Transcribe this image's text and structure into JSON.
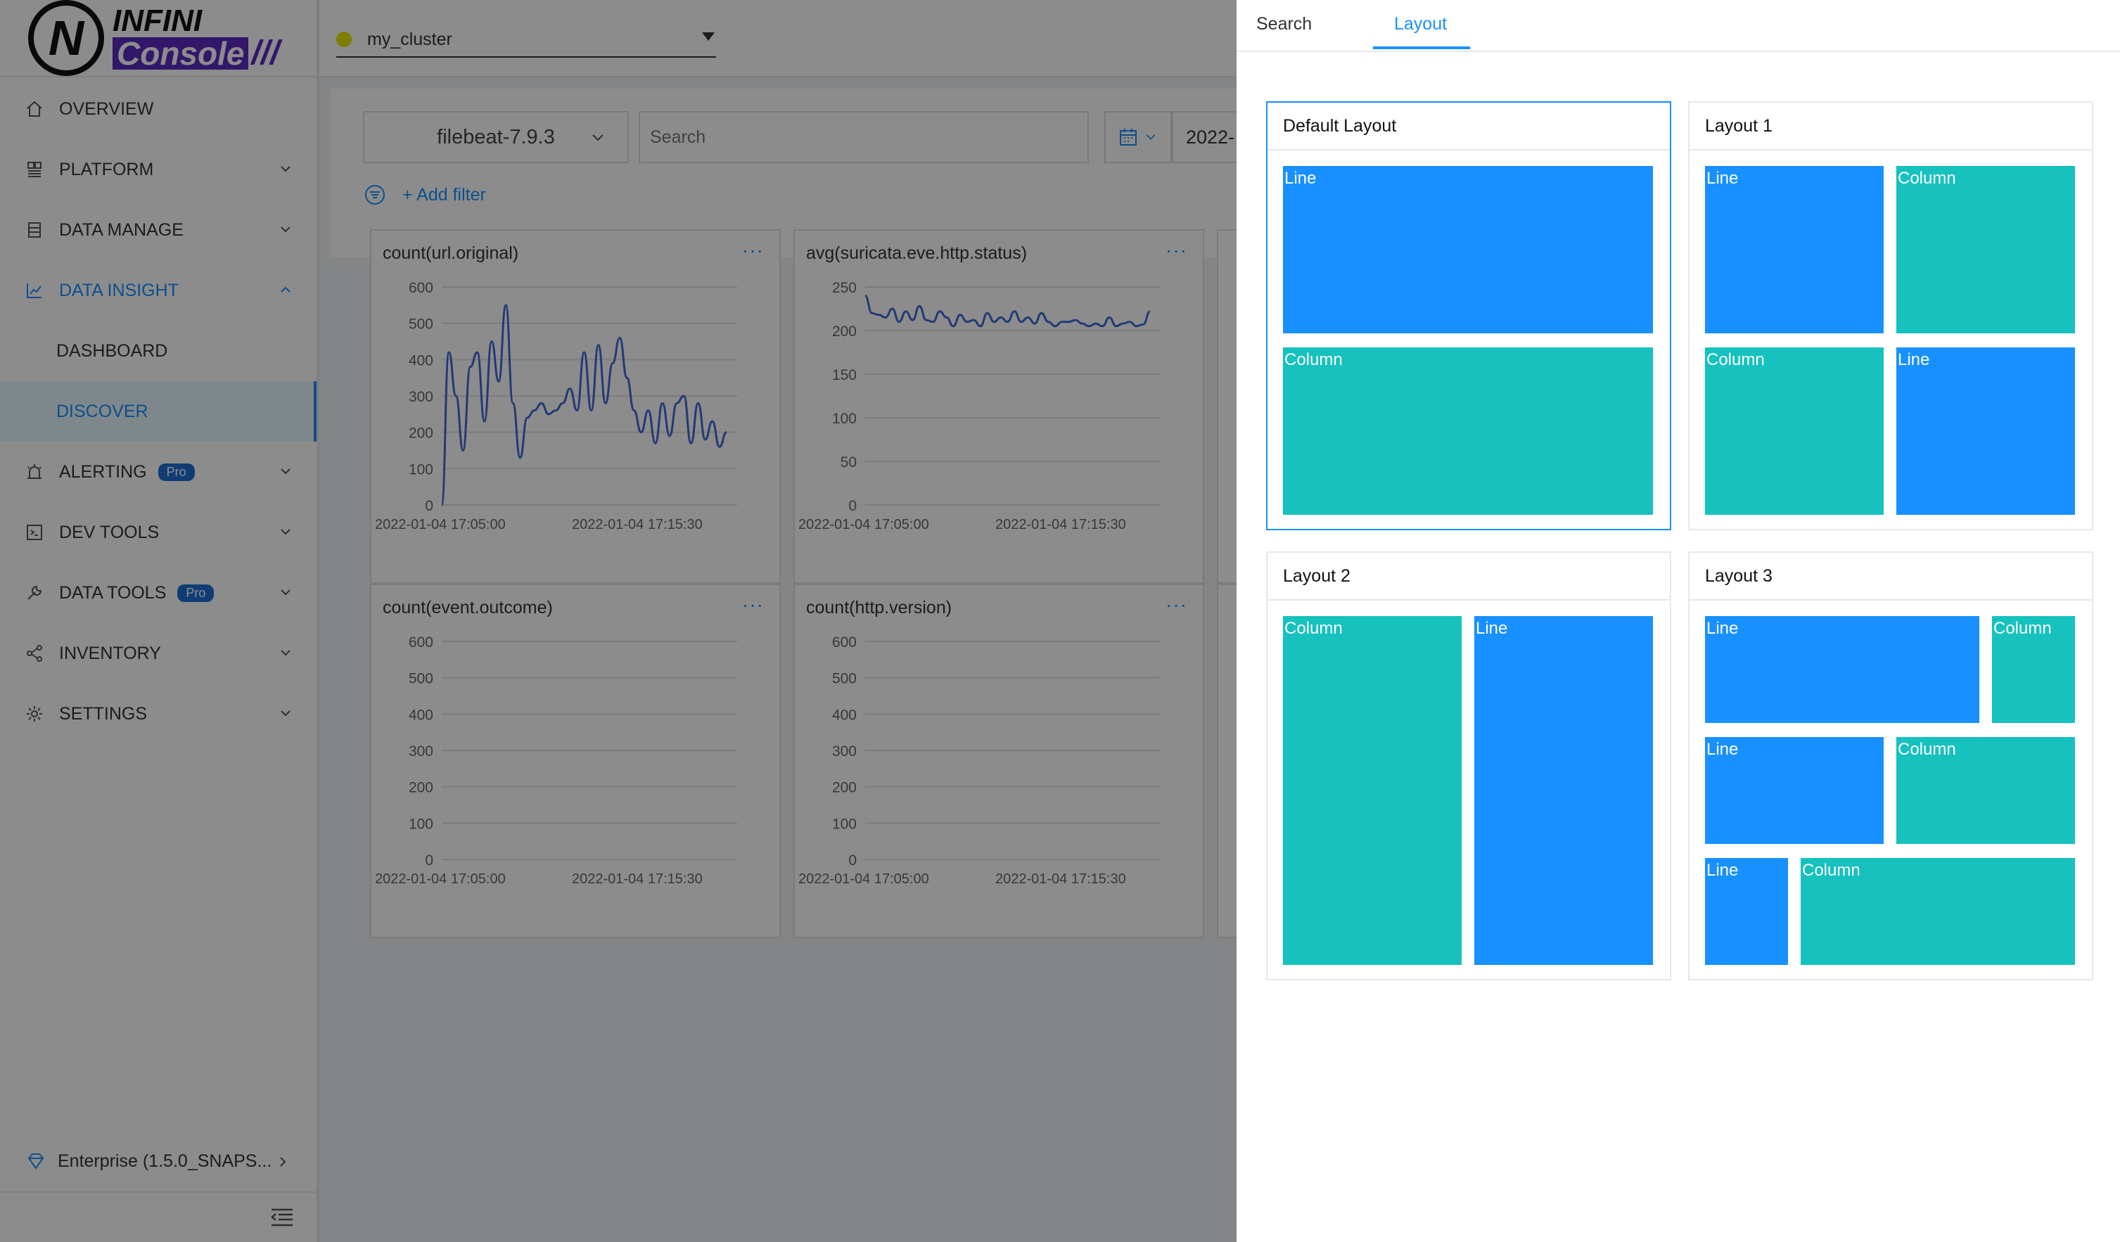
{
  "app": {
    "logo_top": "INFINI",
    "logo_bottom": "Console",
    "logo_slashes": "///"
  },
  "sidebar": {
    "items": [
      {
        "label": "OVERVIEW",
        "icon": "home-icon"
      },
      {
        "label": "PLATFORM",
        "icon": "platform-icon"
      },
      {
        "label": "DATA MANAGE",
        "icon": "database-icon"
      },
      {
        "label": "DATA INSIGHT",
        "icon": "chart-icon"
      },
      {
        "label": "DASHBOARD"
      },
      {
        "label": "DISCOVER"
      },
      {
        "label": "ALERTING",
        "icon": "alarm-icon",
        "badge": "Pro"
      },
      {
        "label": "DEV TOOLS",
        "icon": "code-icon"
      },
      {
        "label": "DATA TOOLS",
        "icon": "wrench-icon",
        "badge": "Pro"
      },
      {
        "label": "INVENTORY",
        "icon": "share-icon"
      },
      {
        "label": "SETTINGS",
        "icon": "gear-icon"
      }
    ],
    "footer_label": "Enterprise (1.5.0_SNAPS...",
    "accent": "#1890ff"
  },
  "topbar": {
    "cluster": "my_cluster"
  },
  "toolbar": {
    "index": "filebeat-7.9.3",
    "search_placeholder": "Search",
    "date_text": "2022-",
    "add_filter": "+ Add filter"
  },
  "panels": [
    {
      "title": "count(url.original)",
      "yticks": [
        "600",
        "500",
        "400",
        "300",
        "200",
        "100",
        "0"
      ],
      "xticks": [
        "2022-01-04 17:05:00",
        "2022-01-04 17:15:30"
      ],
      "ylim": [
        0,
        600
      ]
    },
    {
      "title": "avg(suricata.eve.http.status)",
      "yticks": [
        "250",
        "200",
        "150",
        "100",
        "50",
        "0"
      ],
      "xticks": [
        "2022-01-04 17:05:00",
        "2022-01-04 17:15:30"
      ],
      "ylim": [
        0,
        250
      ]
    },
    {
      "title": "count(event.outcome)",
      "yticks": [
        "600",
        "500",
        "400",
        "300",
        "200",
        "100",
        "0"
      ],
      "xticks": [
        "2022-01-04 17:05:00",
        "2022-01-04 17:15:30"
      ],
      "ylim": [
        0,
        600
      ]
    },
    {
      "title": "count(http.version)",
      "yticks": [
        "600",
        "500",
        "400",
        "300",
        "200",
        "100",
        "0"
      ],
      "xticks": [
        "2022-01-04 17:05:00",
        "2022-01-04 17:15:30"
      ],
      "ylim": [
        0,
        600
      ]
    }
  ],
  "panel_more": "···",
  "chart_data": [
    {
      "type": "line",
      "title": "count(url.original)",
      "ylim": [
        0,
        600
      ],
      "values": [
        0,
        420,
        300,
        150,
        380,
        420,
        230,
        450,
        340,
        550,
        280,
        130,
        240,
        260,
        280,
        250,
        260,
        280,
        320,
        260,
        420,
        260,
        440,
        280,
        390,
        460,
        350,
        260,
        200,
        260,
        170,
        280,
        190,
        280,
        300,
        170,
        280,
        180,
        230,
        160,
        200
      ]
    },
    {
      "type": "line",
      "title": "avg(suricata.eve.http.status)",
      "ylim": [
        0,
        250
      ],
      "values": [
        240,
        220,
        218,
        215,
        225,
        210,
        222,
        212,
        228,
        212,
        210,
        222,
        215,
        205,
        218,
        210,
        212,
        205,
        220,
        210,
        215,
        210,
        222,
        210,
        215,
        208,
        220,
        210,
        205,
        210,
        210,
        212,
        208,
        205,
        208,
        205,
        215,
        205,
        208,
        210,
        205,
        207,
        222
      ]
    },
    {
      "type": "line",
      "title": "count(event.outcome)",
      "ylim": [
        0,
        600
      ],
      "values": []
    },
    {
      "type": "line",
      "title": "count(http.version)",
      "ylim": [
        0,
        600
      ],
      "values": []
    }
  ],
  "drawer": {
    "tabs": [
      "Search",
      "Layout"
    ],
    "active_tab": "Layout",
    "layouts": [
      {
        "title": "Default Layout",
        "selected": true,
        "blocks": [
          "Line",
          "Column"
        ]
      },
      {
        "title": "Layout 1",
        "blocks": [
          "Line",
          "Column",
          "Column",
          "Line"
        ]
      },
      {
        "title": "Layout 2",
        "blocks": [
          "Column",
          "Line"
        ]
      },
      {
        "title": "Layout 3",
        "blocks": [
          "Line",
          "Column",
          "Line",
          "Column",
          "Line",
          "Column"
        ]
      }
    ],
    "colors": {
      "line": "#1890ff",
      "column": "#16c1be"
    }
  }
}
